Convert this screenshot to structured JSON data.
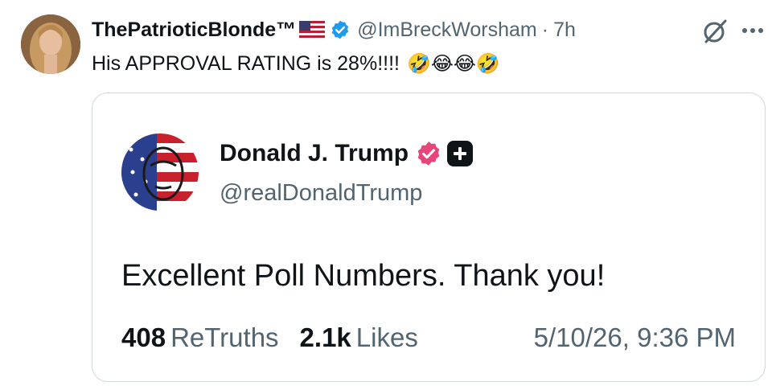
{
  "tweet": {
    "display_name": "ThePatrioticBlonde™",
    "handle": "@ImBreckWorsham",
    "separator": "·",
    "time": "7h",
    "text": "His APPROVAL RATING is 28%!!!!",
    "emojis": "🤣😂😂🤣"
  },
  "embed": {
    "name": "Donald J. Trump",
    "handle": "@realDonaldTrump",
    "text": "Excellent Poll Numbers. Thank you!",
    "retruths_count": "408",
    "retruths_label": "ReTruths",
    "likes_count": "2.1k",
    "likes_label": "Likes",
    "timestamp": "5/10/26, 9:36 PM"
  },
  "colors": {
    "verified_blue": "#1d9bf0",
    "truth_badge_pink": "#e8457a",
    "secondary_text": "#536471",
    "border": "#cfd9de"
  }
}
